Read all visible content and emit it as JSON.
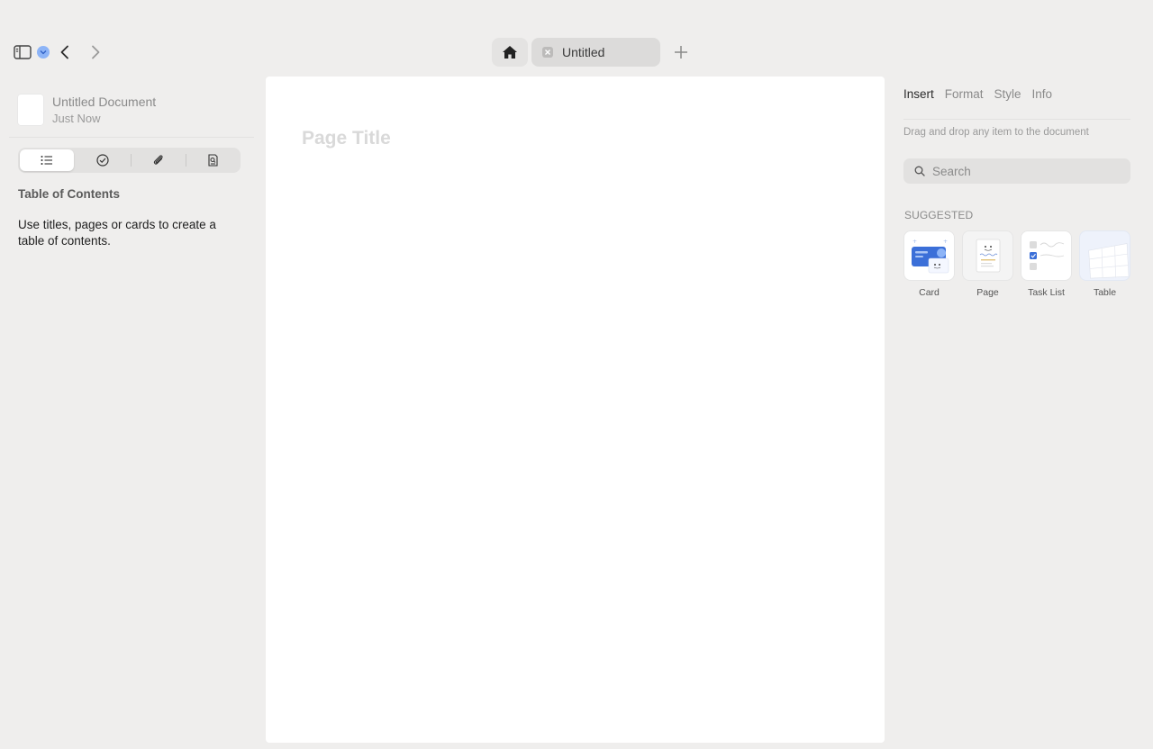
{
  "toolbar": {
    "sidebar_toggle_icon": "sidebar-icon",
    "status_icon": "chevron-circle-icon",
    "back_icon": "chevron-left-icon",
    "forward_icon": "chevron-right-icon"
  },
  "tabs": {
    "home_icon": "home-icon",
    "document_tab_label": "Untitled",
    "new_tab_icon": "plus-icon"
  },
  "sidebar": {
    "document_name": "Untitled Document",
    "document_time": "Just Now",
    "segments": [
      {
        "name": "outline",
        "icon": "list-icon",
        "active": true
      },
      {
        "name": "tasks",
        "icon": "checkmark-circle-icon",
        "active": false
      },
      {
        "name": "attachments",
        "icon": "paperclip-icon",
        "active": false
      },
      {
        "name": "search",
        "icon": "document-search-icon",
        "active": false
      }
    ],
    "toc_title": "Table of Contents",
    "toc_description": "Use titles, pages or cards to create a table of contents."
  },
  "page": {
    "title_placeholder": "Page Title"
  },
  "right_panel": {
    "tabs": [
      {
        "label": "Insert",
        "active": true
      },
      {
        "label": "Format",
        "active": false
      },
      {
        "label": "Style",
        "active": false
      },
      {
        "label": "Info",
        "active": false
      }
    ],
    "hint": "Drag and drop any item to the document",
    "search_placeholder": "Search",
    "suggested_label": "SUGGESTED",
    "items": [
      {
        "label": "Card"
      },
      {
        "label": "Page"
      },
      {
        "label": "Task List"
      },
      {
        "label": "Table"
      }
    ]
  },
  "colors": {
    "background": "#efeeed",
    "accent": "#3b6fd8",
    "badge": "#8db4f7"
  }
}
